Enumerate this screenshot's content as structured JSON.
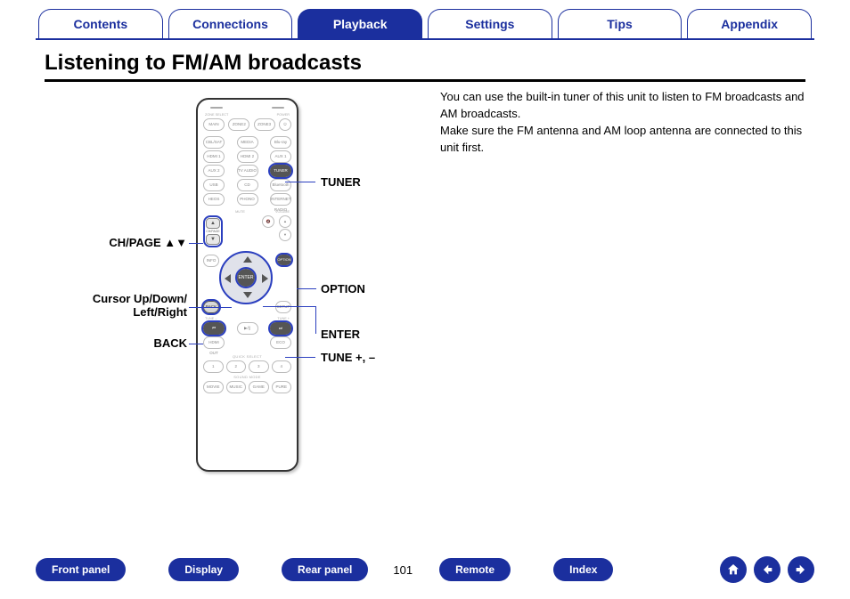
{
  "tabs": {
    "contents": "Contents",
    "connections": "Connections",
    "playback": "Playback",
    "settings": "Settings",
    "tips": "Tips",
    "appendix": "Appendix",
    "active": "playback"
  },
  "heading": "Listening to FM/AM broadcasts",
  "body": {
    "p1": "You can use the built-in tuner of this unit to listen to FM broadcasts and AM broadcasts.",
    "p2": "Make sure the FM antenna and AM loop antenna are connected to this unit first."
  },
  "callouts": {
    "tuner": "TUNER",
    "chpage": "CH/PAGE ",
    "chpage_icons": "▲▼",
    "option": "OPTION",
    "cursor": "Cursor Up/Down/\nLeft/Right",
    "enter": "ENTER",
    "back": "BACK",
    "tune": "TUNE +, –"
  },
  "remote": {
    "zone_label": "ZONE SELECT",
    "power_label": "POWER",
    "main": "MAIN",
    "zone2": "ZONE2",
    "zone3": "ZONE3",
    "power": "⏻",
    "cbl": "CBL/SAT",
    "media": "MEDIA PLAYER",
    "blu": "Blu-ray",
    "hdmi1": "HDMI 1",
    "hdmi2": "HDMI 2",
    "aux1": "AUX 1",
    "aux2": "AUX 2",
    "tvaudio": "TV AUDIO",
    "tuner": "TUNER",
    "usb": "USB",
    "cd": "CD",
    "bluetooth": "Bluetooth",
    "heos": "HEOS",
    "phono": "PHONO",
    "internet": "INTERNET RADIO",
    "chpage_label": "CH/PAGE",
    "mute": "MUTE",
    "volume": "VOLUME",
    "info": "INFO",
    "option": "OPTION",
    "enter": "ENTER",
    "back": "BACK",
    "setup": "SETUP",
    "tune_minus_label": "TUNE –",
    "tune_plus_label": "TUNE +",
    "hdmi_out": "HDMI OUT",
    "eco": "ECO",
    "quick_label": "QUICK SELECT",
    "q1": "1",
    "q2": "2",
    "q3": "3",
    "q4": "4",
    "sound_mode_label": "SOUND MODE",
    "movie": "MOVIE",
    "music": "MUSIC",
    "game": "GAME",
    "pure": "PURE"
  },
  "bottom": {
    "front": "Front panel",
    "display": "Display",
    "rear": "Rear panel",
    "remote": "Remote",
    "index": "Index",
    "page": "101"
  }
}
